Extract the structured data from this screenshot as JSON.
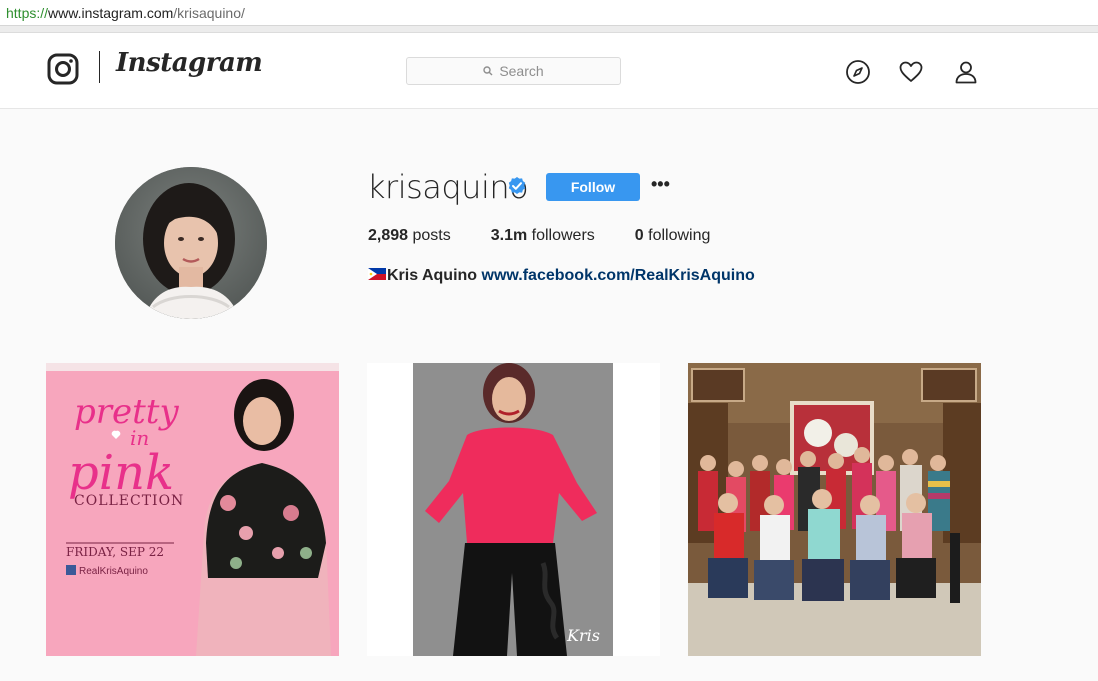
{
  "browser": {
    "url_scheme": "https://",
    "url_host": "www.instagram.com",
    "url_path": "/krisaquino/"
  },
  "nav": {
    "brand": "Instagram",
    "search_placeholder": "Search",
    "icons": [
      "instagram-glyph-icon",
      "search-icon",
      "explore-icon",
      "heart-icon",
      "user-icon"
    ]
  },
  "profile": {
    "username": "krisaquino",
    "verified": true,
    "follow_label": "Follow",
    "more_label": "•••",
    "stats": {
      "posts_count": "2,898",
      "posts_label": " posts",
      "followers_count": "3.1m",
      "followers_label": " followers",
      "following_count": "0",
      "following_label": " following"
    },
    "bio_name": "Kris Aquino",
    "bio_link": "www.facebook.com/RealKrisAquino"
  },
  "posts": [
    {
      "title_line1": "pretty",
      "title_line2": "in",
      "title_line3": "pink",
      "subtitle": "COLLECTION",
      "date": "FRIDAY, SEP 22",
      "handle": "RealKrisAquino"
    },
    {
      "signature": "Kris"
    },
    {}
  ],
  "colors": {
    "accent": "#3897f0",
    "link": "#003569",
    "verified": "#3897f0",
    "pink": "#f7a6bd",
    "magenta": "#e8308a"
  }
}
